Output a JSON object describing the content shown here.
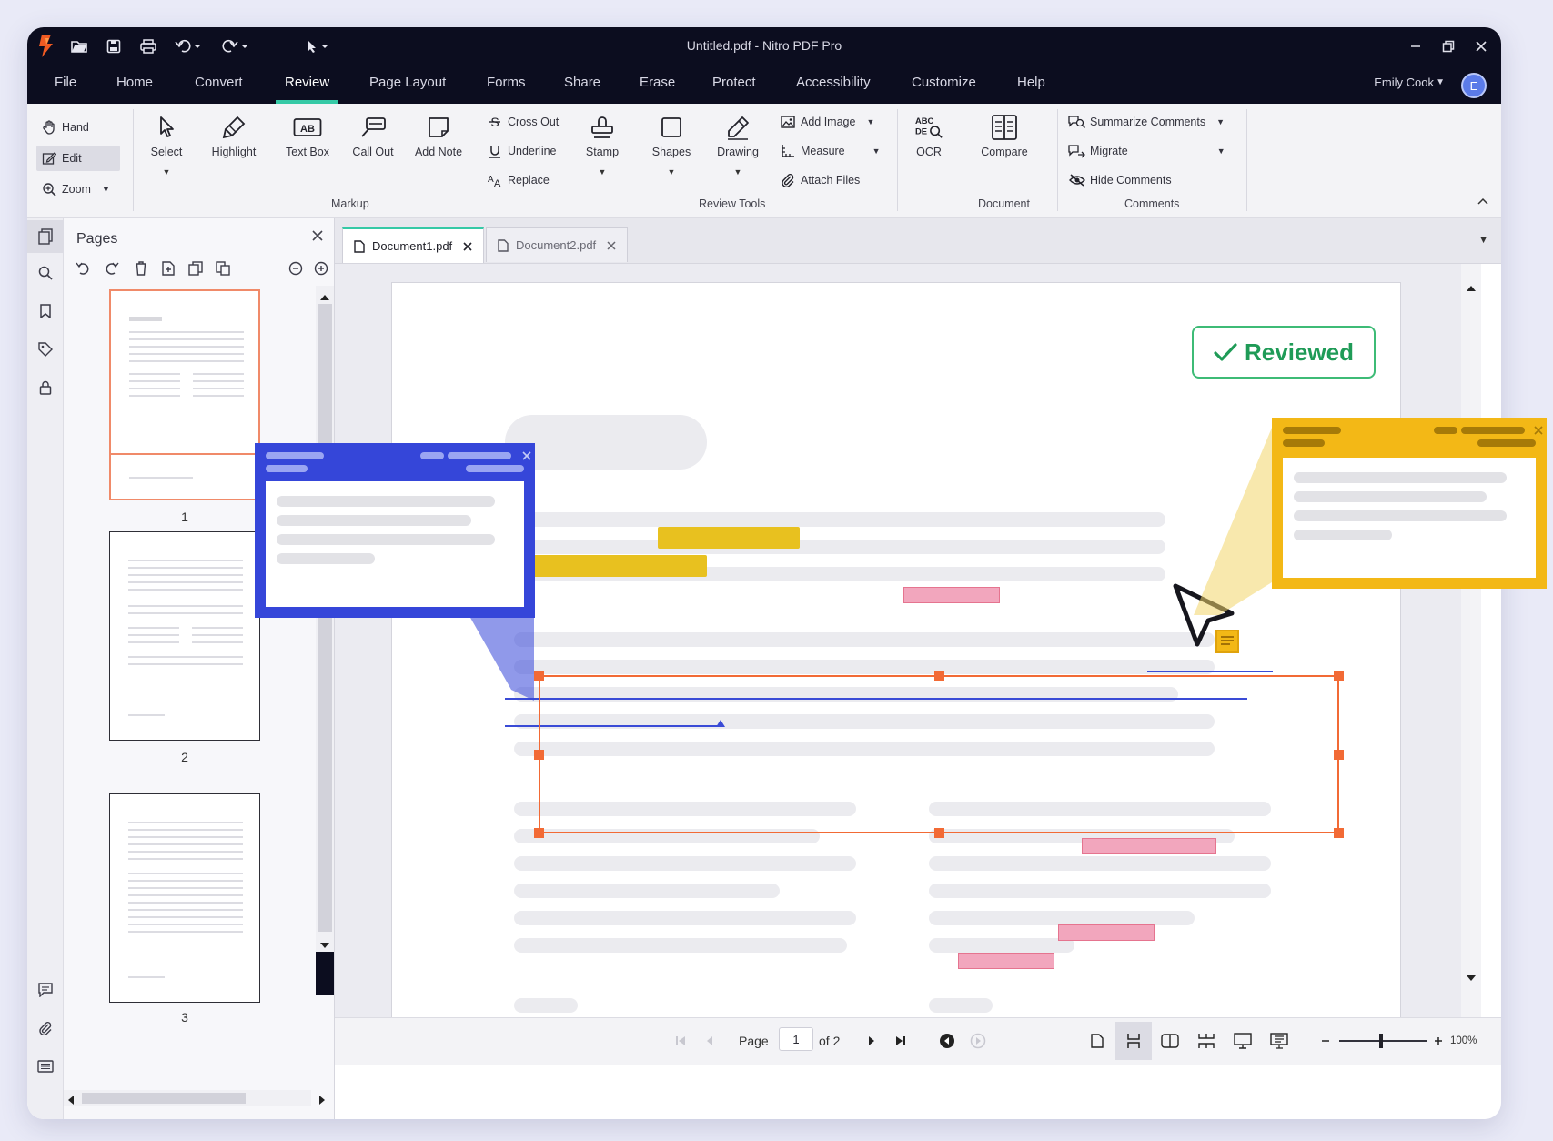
{
  "window": {
    "title": "Untitled.pdf - Nitro PDF Pro"
  },
  "menu": [
    "File",
    "Home",
    "Convert",
    "Review",
    "Page Layout",
    "Forms",
    "Share",
    "Erase",
    "Protect",
    "Accessibility",
    "Customize",
    "Help"
  ],
  "active_menu": "Review",
  "user": {
    "name": "Emily Cook",
    "initial": "E"
  },
  "ribbon": {
    "nav": {
      "hand": "Hand",
      "edit": "Edit",
      "zoom": "Zoom"
    },
    "markup": {
      "select": "Select",
      "highlight": "Highlight",
      "text_box": "Text Box",
      "call_out": "Call Out",
      "add_note": "Add Note",
      "cross_out": "Cross Out",
      "underline": "Underline",
      "replace": "Replace",
      "group": "Markup"
    },
    "review_tools": {
      "stamp": "Stamp",
      "shapes": "Shapes",
      "drawing": "Drawing",
      "add_image": "Add Image",
      "measure": "Measure",
      "attach_files": "Attach Files",
      "group": "Review Tools"
    },
    "document": {
      "ocr": "OCR",
      "compare": "Compare",
      "group": "Document",
      "ocr_icon_text": "ABC\nDEQ"
    },
    "comments": {
      "summarize": "Summarize Comments",
      "migrate": "Migrate",
      "hide": "Hide Comments",
      "group": "Comments"
    }
  },
  "pages_panel": {
    "title": "Pages",
    "thumbnails": [
      "1",
      "2",
      "3"
    ]
  },
  "tabs": [
    {
      "label": "Document1.pdf",
      "active": true
    },
    {
      "label": "Document2.pdf",
      "active": false
    }
  ],
  "document": {
    "stamp_text": "Reviewed"
  },
  "statusbar": {
    "page_label": "Page",
    "page_value": "1",
    "page_total": "of 2",
    "zoom": "100%"
  },
  "colors": {
    "accent": "#35c9a6",
    "selection": "#f26a35",
    "popup_blue": "#3546d9",
    "popup_yellow": "#f3b816",
    "reviewed_green": "#1f9b57"
  }
}
